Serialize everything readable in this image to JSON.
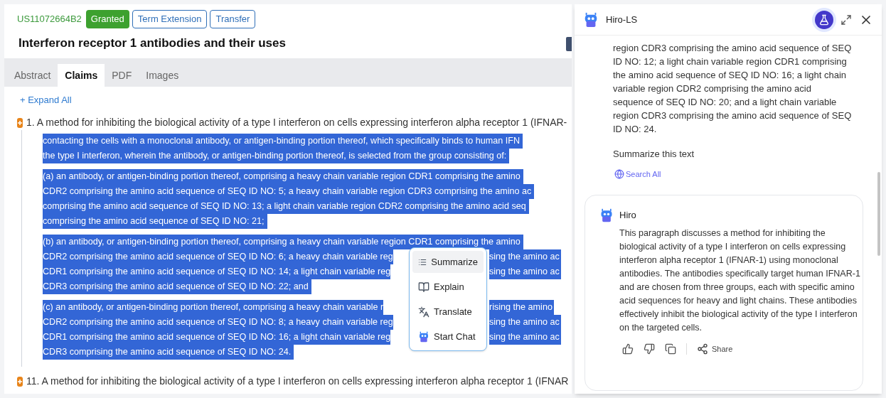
{
  "patent": {
    "number": "US11072664B2",
    "status": "Granted",
    "tags": [
      "Term Extension",
      "Transfer"
    ],
    "title": "Interferon receptor 1 antibodies and their uses"
  },
  "tabs": [
    {
      "label": "Abstract",
      "selected": false
    },
    {
      "label": "Claims",
      "selected": true
    },
    {
      "label": "PDF",
      "selected": false
    },
    {
      "label": "Images",
      "selected": false
    }
  ],
  "expand_all": "+ Expand All",
  "claims": [
    {
      "heading": "1. A method for inhibiting the biological activity of a type I interferon on cells expressing interferon alpha receptor 1 (IFNAR-",
      "paragraphs": [
        {
          "lines": [
            {
              "text": "contacting the cells with a monoclonal antibody, or antigen-binding portion thereof, which specifically binds to human IFN"
            },
            {
              "text": "the type I interferon, wherein the antibody, or antigen-binding portion thereof, is selected from the group consisting of:"
            }
          ]
        },
        {
          "lines": [
            {
              "text": "(a) an antibody, or antigen-binding portion thereof, comprising a heavy chain variable region CDR1 comprising the amino"
            },
            {
              "text": "CDR2 comprising the amino acid sequence of SEQ ID NO: 5; a heavy chain variable region CDR3 comprising the amino ac"
            },
            {
              "text": "comprising the amino acid sequence of SEQ ID NO: 13; a light chain variable region CDR2 comprising the amino acid seq"
            },
            {
              "text": "comprising the amino acid sequence of SEQ ID NO: 21;"
            }
          ]
        },
        {
          "lines": [
            {
              "text": "(b) an antibody, or antigen-binding portion thereof, comprising a heavy chain variable region CDR1 comprising the amino"
            },
            {
              "text": "CDR2 comprising the amino acid sequence of SEQ ID NO: 6; a heavy chain variable reg",
              "after": "sing the amino ac"
            },
            {
              "text": "CDR1 comprising the amino acid sequence of SEQ ID NO: 14; a light chain variable reg",
              "after": "sing the amino ac"
            },
            {
              "text": "CDR3 comprising the amino acid sequence of SEQ ID NO: 22; and"
            }
          ]
        },
        {
          "lines": [
            {
              "text": "(c) an antibody, or antigen-binding portion thereof, comprising a heavy chain variable r",
              "after": "rising the amino"
            },
            {
              "text": "CDR2 comprising the amino acid sequence of SEQ ID NO: 8; a heavy chain variable reg",
              "after": "sing the amino ac"
            },
            {
              "text": "CDR1 comprising the amino acid sequence of SEQ ID NO: 16; a light chain variable reg",
              "after": "sing the amino ac"
            },
            {
              "text": "CDR3 comprising the amino acid sequence of SEQ ID NO: 24."
            }
          ]
        }
      ]
    },
    {
      "heading": "11. A method for inhibiting the biological activity of a type I interferon on cells expressing interferon alpha receptor 1 (IFNAR"
    }
  ],
  "context_menu": [
    {
      "label": "Summarize",
      "kind": "list",
      "selected": true
    },
    {
      "label": "Explain",
      "kind": "book",
      "selected": false
    },
    {
      "label": "Translate",
      "kind": "translate",
      "selected": false
    },
    {
      "label": "Start Chat",
      "kind": "bot",
      "selected": false
    }
  ],
  "assistant": {
    "title": "Hiro-LS",
    "user_message": "region CDR3 comprising the amino acid sequence of SEQ ID NO: 12; a light chain variable region CDR1 comprising the amino acid sequence of SEQ ID NO: 16; a light chain variable region CDR2 comprising the amino acid sequence of SEQ ID NO: 20; and a light chain variable region CDR3 comprising the amino acid sequence of SEQ ID NO: 24.",
    "user_prompt": "Summarize this text",
    "search_link": "Search All",
    "reply": {
      "name": "Hiro",
      "text": "This paragraph discusses a method for inhibiting the biological activity of a type I interferon on cells expressing interferon alpha receptor 1 (IFNAR-1) using monoclonal antibodies. The antibodies specifically target human IFNAR-1 and are chosen from three groups, each with specific amino acid sequences for heavy and light chains. These antibodies effectively inhibit the biological activity of the type I interferon on the targeted cells.",
      "share": "Share"
    }
  }
}
